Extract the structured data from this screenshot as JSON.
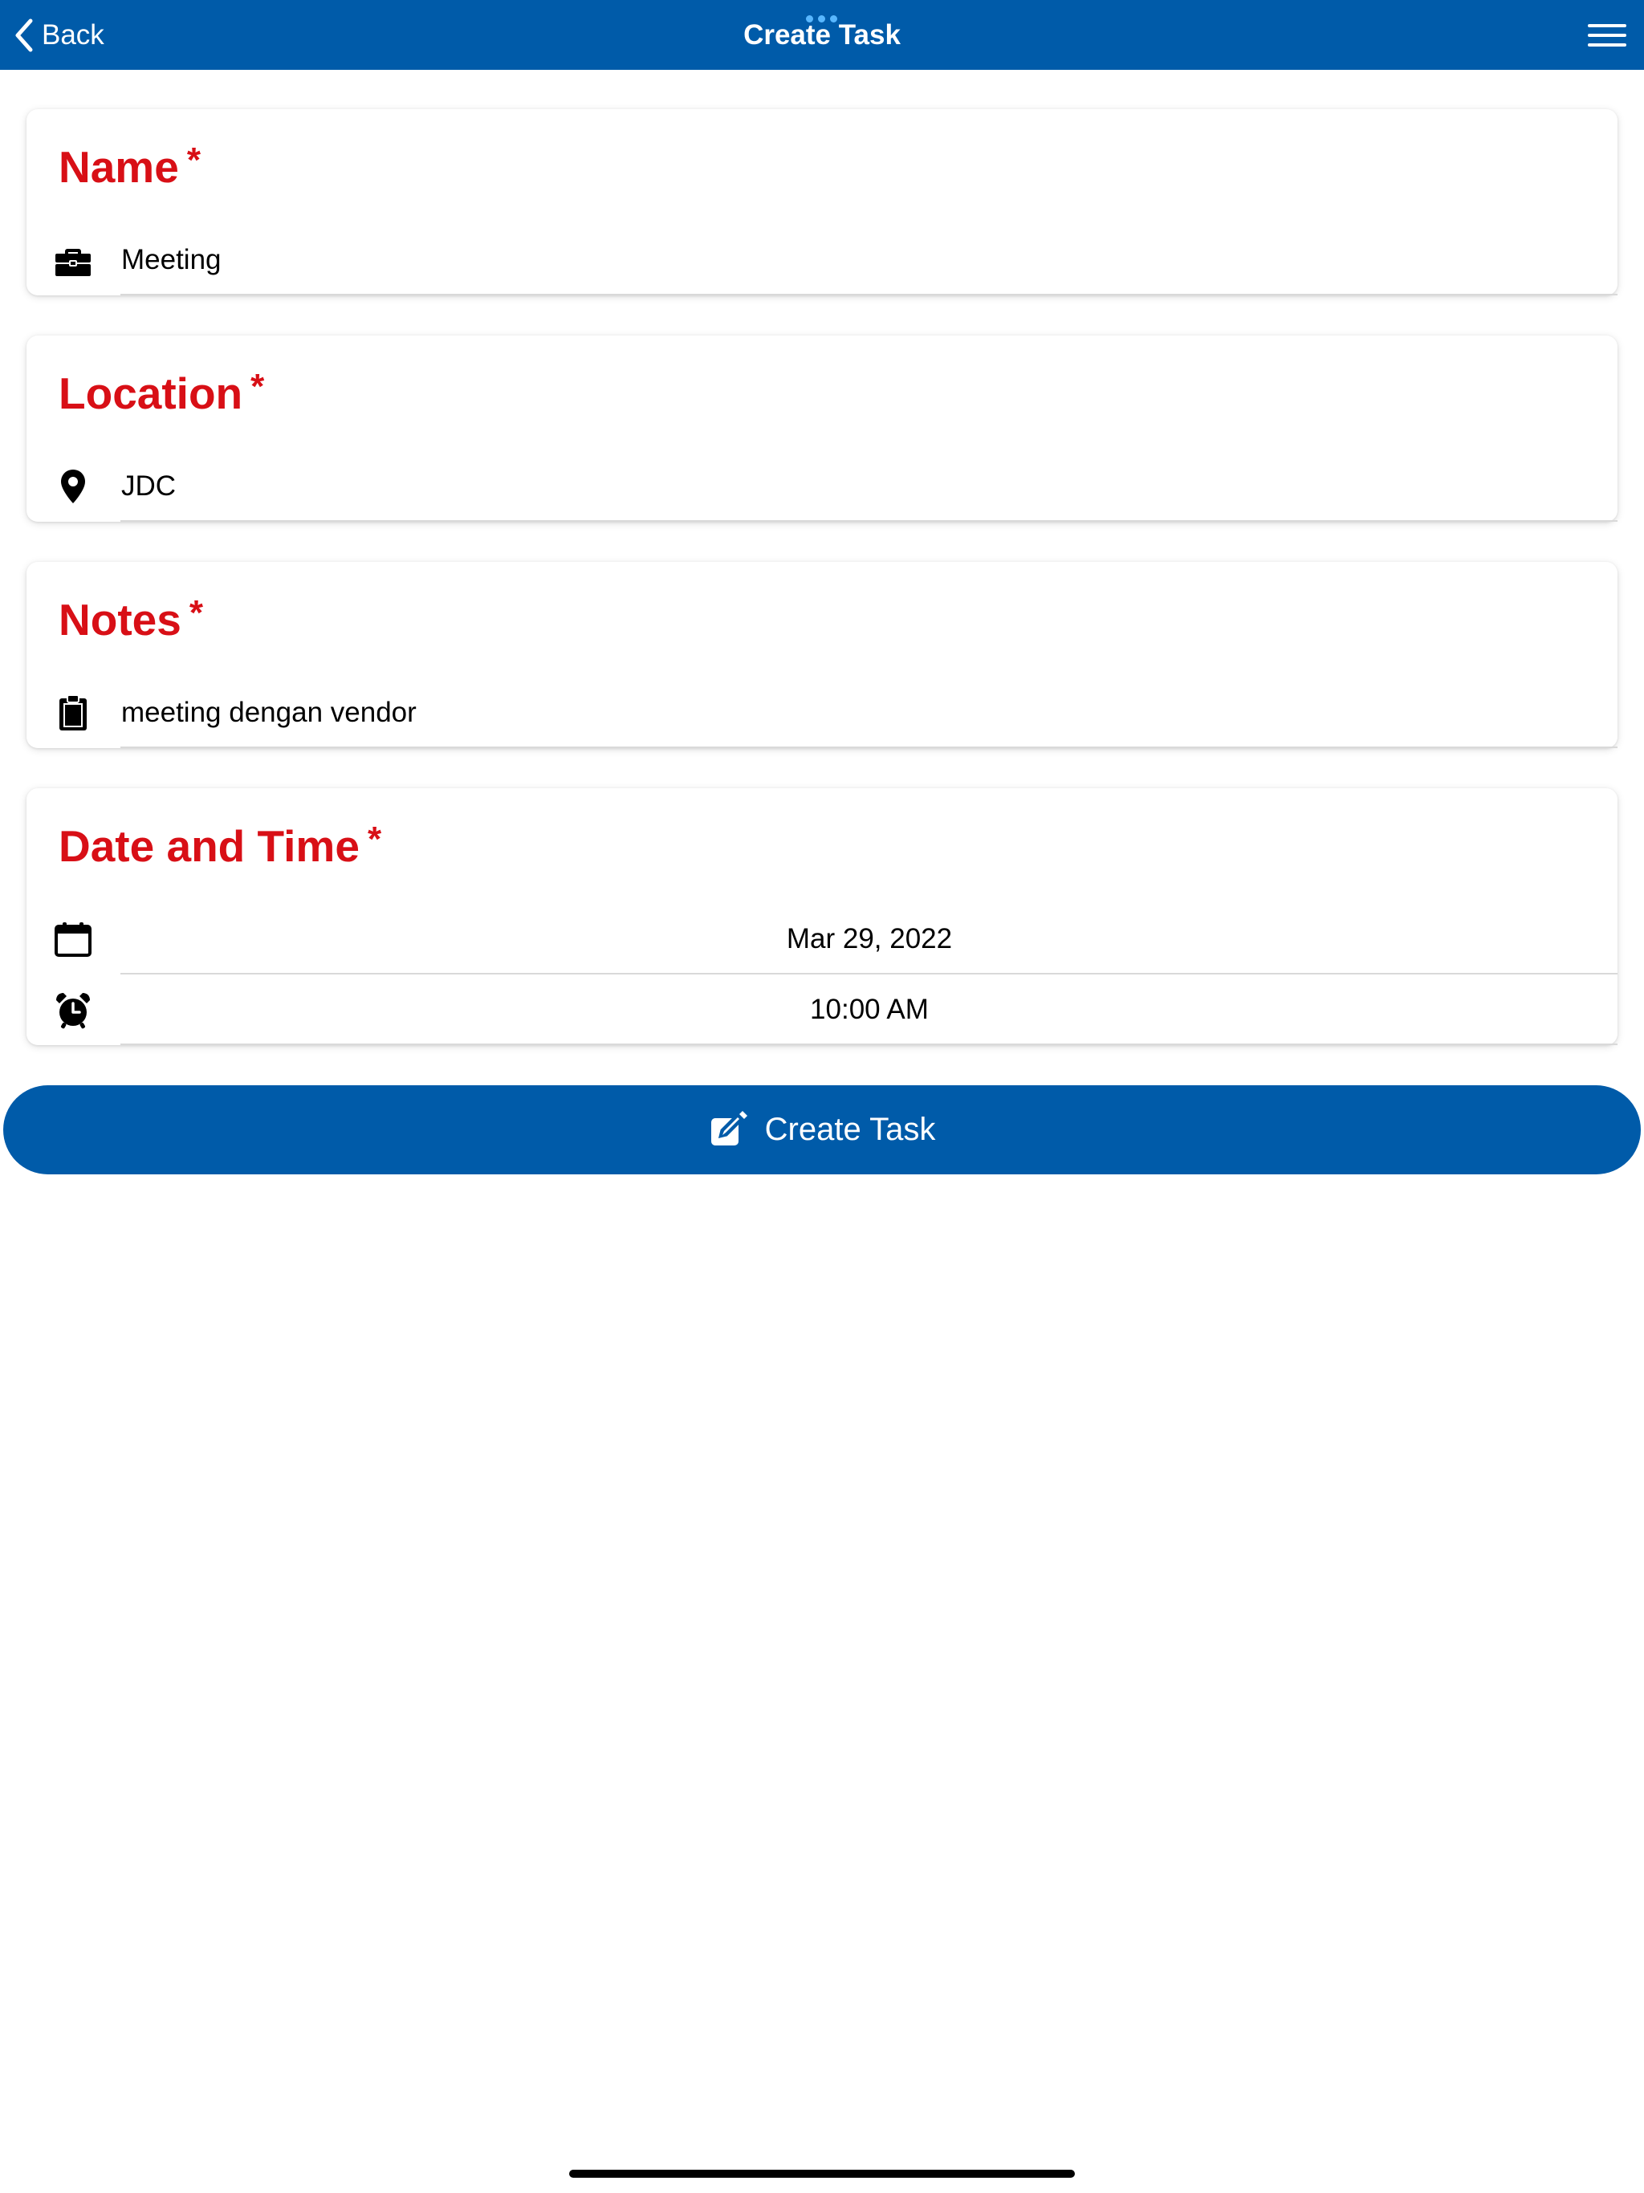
{
  "navbar": {
    "back_label": "Back",
    "title": "Create Task",
    "icons": {
      "back": "chevron-left-icon",
      "menu": "hamburger-menu-icon"
    }
  },
  "form": {
    "name": {
      "title": "Name",
      "required_mark": "*",
      "value": "Meeting",
      "icon": "briefcase-icon"
    },
    "location": {
      "title": "Location",
      "required_mark": "*",
      "value": "JDC",
      "icon": "map-pin-icon"
    },
    "notes": {
      "title": "Notes",
      "required_mark": "*",
      "value": "meeting dengan vendor",
      "icon": "clipboard-icon"
    },
    "datetime": {
      "title": "Date and Time",
      "required_mark": "*",
      "date": "Mar 29, 2022",
      "time": "10:00 AM",
      "date_icon": "calendar-icon",
      "time_icon": "alarm-clock-icon"
    }
  },
  "submit": {
    "label": "Create Task",
    "icon": "edit-square-icon"
  },
  "colors": {
    "primary": "#005ba9",
    "label_red": "#d80f16",
    "background": "#ffffff"
  }
}
